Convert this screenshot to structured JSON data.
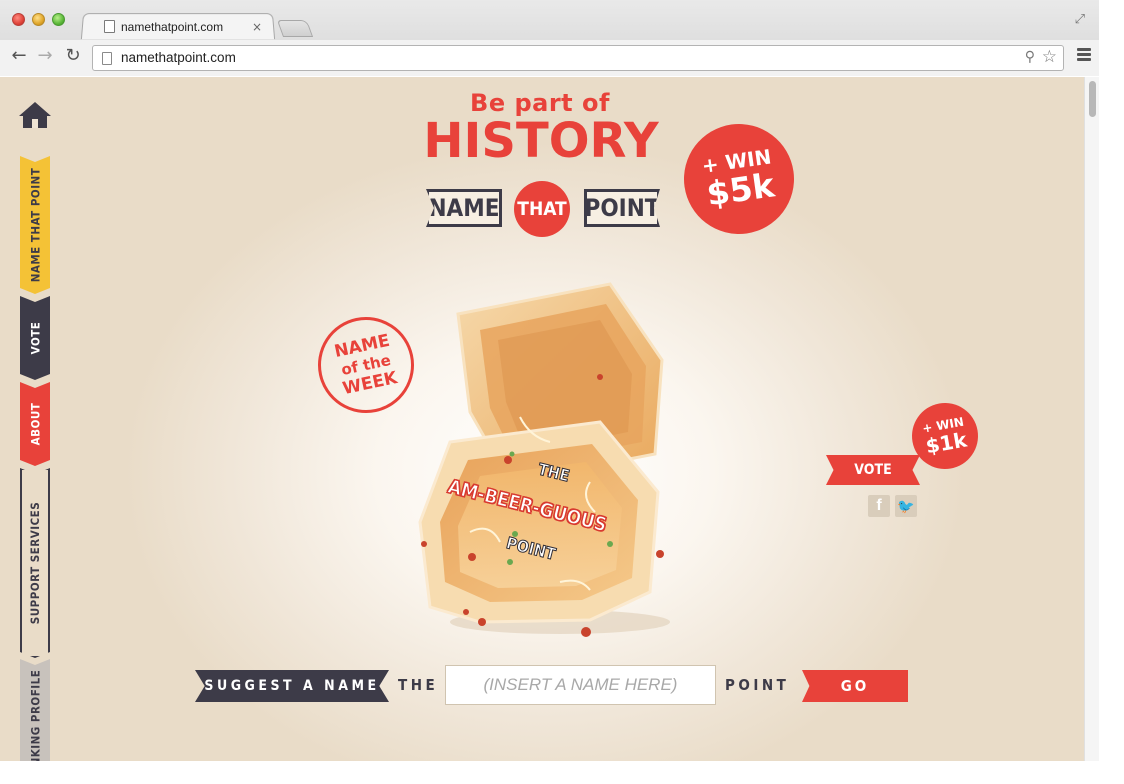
{
  "browser": {
    "tab_title": "namethatpoint.com",
    "tab_close": "×",
    "url": "namethatpoint.com"
  },
  "side_nav": {
    "items": [
      {
        "label": "NAME THAT POINT"
      },
      {
        "label": "VOTE"
      },
      {
        "label": "ABOUT"
      },
      {
        "label": "SUPPORT SERVICES"
      },
      {
        "label": "DRINKING PROFILE"
      }
    ]
  },
  "hero": {
    "line1": "Be part of",
    "line2": "HISTORY",
    "logo_name": "NAME",
    "logo_that": "THAT",
    "logo_point": "POINT",
    "win_big_line1": "+ WIN",
    "win_big_line2": "$5k"
  },
  "feature": {
    "stamp_line1": "NAME",
    "stamp_line2": "of the",
    "stamp_line3": "WEEK",
    "point_the": "THE",
    "point_name": "AM-BEER-GUOUS",
    "point_suffix": "POINT",
    "win_small_line1": "+ WIN",
    "win_small_line2": "$1k",
    "vote_label": "VOTE"
  },
  "suggest": {
    "label": "SUGGEST A NAME",
    "prefix": "THE",
    "placeholder": "(INSERT A NAME HERE)",
    "suffix": "POINT",
    "go_label": "GO"
  },
  "colors": {
    "accent_red": "#e8423a",
    "dark_slate": "#3d3b48",
    "yellow": "#f4c236",
    "background": "#efe4d4"
  }
}
